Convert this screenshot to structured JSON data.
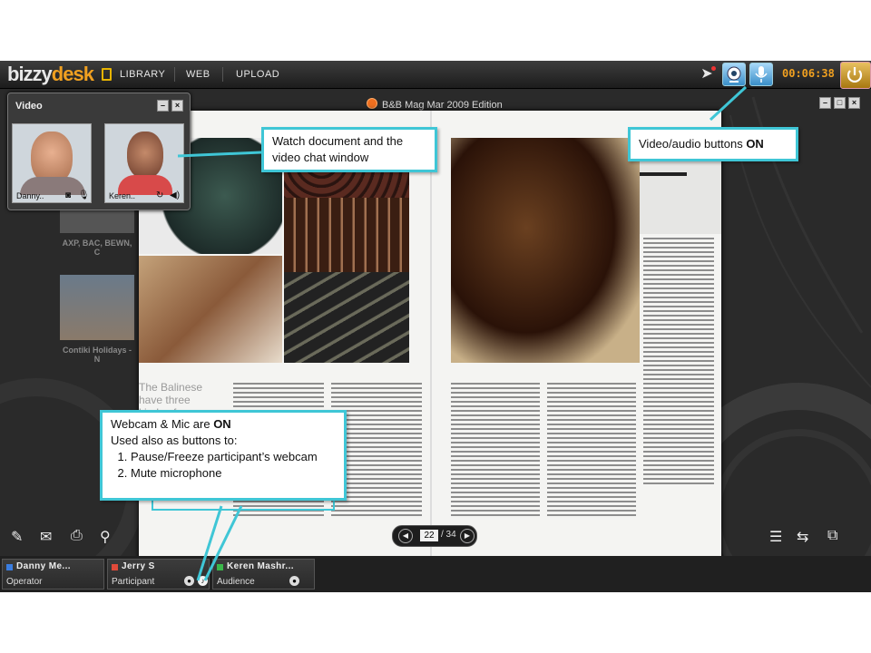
{
  "app": {
    "logo_a": "bizzy",
    "logo_b": "desk",
    "nav": [
      "LIBRARY",
      "WEB",
      "UPLOAD"
    ],
    "timer": "00:06:38"
  },
  "viewer": {
    "title": "B&B Mag Mar 2009 Edition",
    "headline": "The Balinese have three kinds of",
    "page_current": "22",
    "page_total": "/ 34"
  },
  "library": {
    "thumb1_caption": "AXP, BAC, BEWN, C",
    "thumb2_caption": "Contiki Holidays - N"
  },
  "video_window": {
    "title": "Video",
    "participants": [
      {
        "name": "Danny..",
        "icons": [
          "webcam-icon",
          "microphone-icon"
        ]
      },
      {
        "name": "Keren..",
        "icons": [
          "refresh-icon",
          "speaker-icon"
        ]
      }
    ]
  },
  "participants_bar": [
    {
      "name": "Danny Me...",
      "role": "Operator",
      "color": "#3a7de0"
    },
    {
      "name": "Jerry S",
      "role": "Participant",
      "color": "#e04a3a"
    },
    {
      "name": "Keren Mashr...",
      "role": "Audience",
      "color": "#3ab84a"
    }
  ],
  "callouts": {
    "watch": "Watch document and the video chat window",
    "av_prefix": "Video/audio buttons ",
    "av_on": "ON",
    "webcam_line1_prefix": "Webcam & Mic are ",
    "webcam_line1_on": "ON",
    "webcam_line2": "Used also as buttons to:",
    "webcam_items": [
      "Pause/Freeze participant’s  webcam",
      "Mute microphone"
    ]
  },
  "colors": {
    "callout_border": "#3fc6d6",
    "accent": "#f0a020"
  }
}
